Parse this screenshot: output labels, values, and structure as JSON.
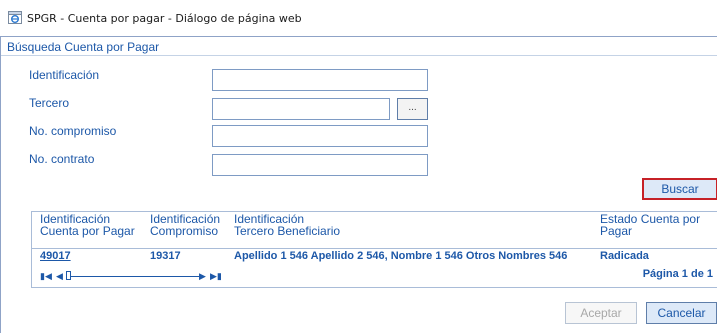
{
  "window": {
    "title": "SPGR - Cuenta por pagar - Diálogo de página web"
  },
  "form": {
    "section_title": "Búsqueda Cuenta por Pagar",
    "identificacion_label": "Identificación",
    "identificacion_value": "",
    "tercero_label": "Tercero",
    "tercero_value": "",
    "tercero_button": "...",
    "compromiso_label": "No. compromiso",
    "compromiso_value": "",
    "contrato_label": "No. contrato",
    "contrato_value": "",
    "buscar_label": "Buscar"
  },
  "grid": {
    "headers": [
      {
        "line1": "Identificación",
        "line2": "Cuenta por Pagar"
      },
      {
        "line1": "Identificación",
        "line2": "Compromiso"
      },
      {
        "line1": "Identificación",
        "line2": "Tercero Beneficiario"
      },
      {
        "line1": "Estado Cuenta por",
        "line2": "Pagar"
      }
    ],
    "rows": [
      {
        "cuenta": "49017",
        "compromiso": "19317",
        "tercero": "Apellido 1 546 Apellido 2 546, Nombre 1 546 Otros Nombres 546",
        "estado": "Radicada"
      }
    ],
    "pager": {
      "page_label": "Página 1 de 1"
    }
  },
  "footer": {
    "aceptar_label": "Aceptar",
    "cancelar_label": "Cancelar"
  },
  "colors": {
    "accent": "#1d58a8",
    "highlight_border": "#c62127",
    "button_bg": "#dde9f8"
  }
}
